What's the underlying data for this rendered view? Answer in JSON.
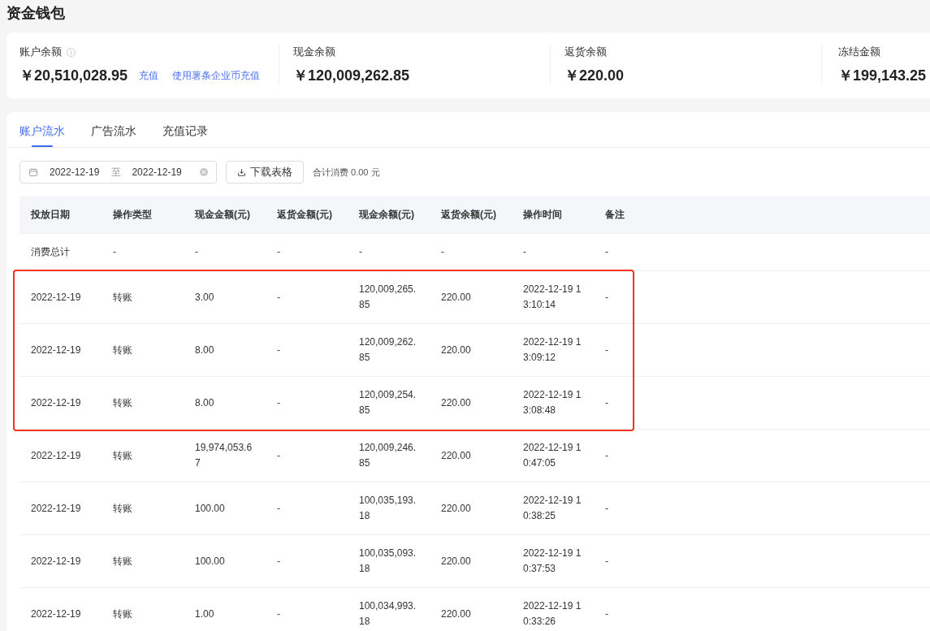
{
  "page_title": "资金钱包",
  "balances": [
    {
      "label": "账户余额",
      "info_icon": true,
      "value": "￥20,510,028.95",
      "links": [
        "充值",
        "使用薯条企业币充值"
      ]
    },
    {
      "label": "现金余额",
      "info_icon": false,
      "value": "￥120,009,262.85"
    },
    {
      "label": "返货余额",
      "info_icon": false,
      "value": "￥220.00"
    },
    {
      "label": "冻结金额",
      "info_icon": false,
      "value": "￥199,143.25"
    }
  ],
  "tabs": [
    {
      "label": "账户流水",
      "selected": true
    },
    {
      "label": "广告流水",
      "selected": false
    },
    {
      "label": "充值记录",
      "selected": false
    }
  ],
  "filters": {
    "date_range": {
      "start": "2022-12-19",
      "separator": "至",
      "end": "2022-12-19"
    },
    "download_button": "下载表格",
    "total_spend": "合计消费 0.00 元"
  },
  "table": {
    "columns": [
      "投放日期",
      "操作类型",
      "现金金额(元)",
      "返货金额(元)",
      "现金余额(元)",
      "返货余额(元)",
      "操作时间",
      "备注"
    ],
    "summary_row": [
      "消费总计",
      "-",
      "-",
      "-",
      "-",
      "-",
      "-",
      "-"
    ],
    "rows": [
      {
        "highlighted": true,
        "cells": [
          "2022-12-19",
          "转账",
          "3.00",
          "-",
          "120,009,265.85",
          "220.00",
          "2022-12-19 13:10:14",
          "-"
        ]
      },
      {
        "highlighted": true,
        "cells": [
          "2022-12-19",
          "转账",
          "8.00",
          "-",
          "120,009,262.85",
          "220.00",
          "2022-12-19 13:09:12",
          "-"
        ]
      },
      {
        "highlighted": true,
        "cells": [
          "2022-12-19",
          "转账",
          "8.00",
          "-",
          "120,009,254.85",
          "220.00",
          "2022-12-19 13:08:48",
          "-"
        ]
      },
      {
        "highlighted": false,
        "cells": [
          "2022-12-19",
          "转账",
          "19,974,053.67",
          "-",
          "120,009,246.85",
          "220.00",
          "2022-12-19 10:47:05",
          "-"
        ]
      },
      {
        "highlighted": false,
        "cells": [
          "2022-12-19",
          "转账",
          "100.00",
          "-",
          "100,035,193.18",
          "220.00",
          "2022-12-19 10:38:25",
          "-"
        ]
      },
      {
        "highlighted": false,
        "cells": [
          "2022-12-19",
          "转账",
          "100.00",
          "-",
          "100,035,093.18",
          "220.00",
          "2022-12-19 10:37:53",
          "-"
        ]
      },
      {
        "highlighted": false,
        "cells": [
          "2022-12-19",
          "转账",
          "1.00",
          "-",
          "100,034,993.18",
          "220.00",
          "2022-12-19 10:33:26",
          "-"
        ]
      }
    ]
  }
}
